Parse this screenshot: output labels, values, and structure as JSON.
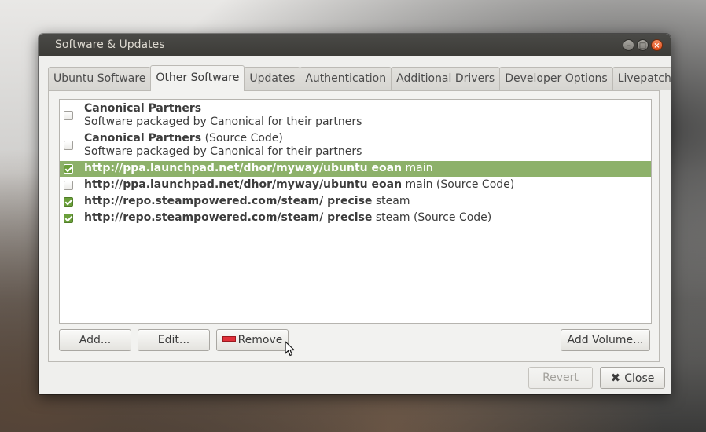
{
  "window": {
    "title": "Software & Updates"
  },
  "tabs": [
    {
      "label": "Ubuntu Software"
    },
    {
      "label": "Other Software",
      "active": true
    },
    {
      "label": "Updates"
    },
    {
      "label": "Authentication"
    },
    {
      "label": "Additional Drivers"
    },
    {
      "label": "Developer Options"
    },
    {
      "label": "Livepatch"
    }
  ],
  "sources": [
    {
      "checked": false,
      "selected": false,
      "bold": "Canonical Partners",
      "suffix": "",
      "description": "Software packaged by Canonical for their partners"
    },
    {
      "checked": false,
      "selected": false,
      "bold": "Canonical Partners",
      "suffix": " (Source Code)",
      "description": "Software packaged by Canonical for their partners"
    },
    {
      "checked": true,
      "selected": true,
      "bold": "http://ppa.launchpad.net/dhor/myway/ubuntu eoan",
      "suffix": " main"
    },
    {
      "checked": false,
      "selected": false,
      "bold": "http://ppa.launchpad.net/dhor/myway/ubuntu eoan",
      "suffix": " main (Source Code)"
    },
    {
      "checked": true,
      "selected": false,
      "bold": "http://repo.steampowered.com/steam/ precise",
      "suffix": " steam"
    },
    {
      "checked": true,
      "selected": false,
      "bold": "http://repo.steampowered.com/steam/ precise",
      "suffix": " steam (Source Code)"
    }
  ],
  "buttons": {
    "add": "Add...",
    "edit": "Edit...",
    "remove": "Remove",
    "add_volume": "Add Volume...",
    "revert": "Revert",
    "close": "Close"
  },
  "icons": {
    "remove": "remove-icon",
    "close": "close-icon",
    "cursor": "mouse-pointer-icon"
  },
  "colors": {
    "selection": "#8db16a",
    "checkbox_checked": "#6a9f3a",
    "titlebar": "#3c3b37",
    "close_button": "#df4a16"
  }
}
